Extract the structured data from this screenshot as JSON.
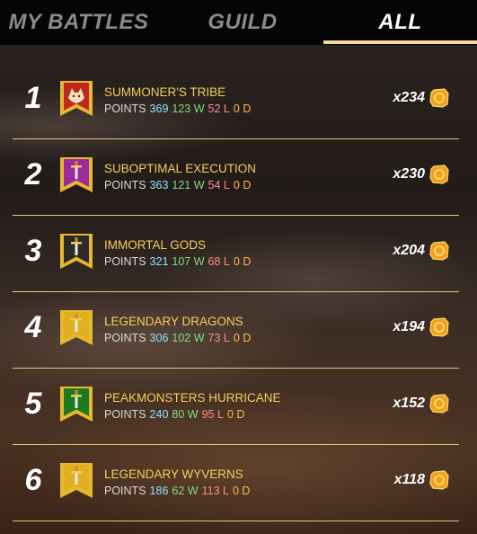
{
  "tabs": [
    {
      "label": "MY BATTLES"
    },
    {
      "label": "GUILD"
    },
    {
      "label": "ALL",
      "active": true
    }
  ],
  "stat_labels": {
    "points": "POINTS",
    "wins_suffix": "W",
    "losses_suffix": "L",
    "draws_suffix": "D"
  },
  "colors": {
    "accent": "#f3d99b",
    "team_name": "#f4cf5e",
    "points": "#8ee3ff",
    "wins": "#7fdc7f",
    "losses": "#ff8a8a",
    "draws": "#ffb84d"
  },
  "rows": [
    {
      "rank": "1",
      "name": "SUMMONER'S TRIBE",
      "points": "369",
      "wins": "123 W",
      "losses": "52 L",
      "draws": "0 D",
      "reward": "x234",
      "banner_icon": "wolf-banner-icon",
      "banner_color": "#c0281e"
    },
    {
      "rank": "2",
      "name": "SUBOPTIMAL EXECUTION",
      "points": "363",
      "wins": "121 W",
      "losses": "54 L",
      "draws": "0 D",
      "reward": "x230",
      "banner_icon": "sword-banner-icon",
      "banner_color": "#9a2a9e"
    },
    {
      "rank": "3",
      "name": "IMMORTAL GODS",
      "points": "321",
      "wins": "107 W",
      "losses": "68 L",
      "draws": "0 D",
      "reward": "x204",
      "banner_icon": "sword-banner-icon",
      "banner_color": "#2a2a2a"
    },
    {
      "rank": "4",
      "name": "LEGENDARY DRAGONS",
      "points": "306",
      "wins": "102 W",
      "losses": "73 L",
      "draws": "0 D",
      "reward": "x194",
      "banner_icon": "sword-banner-icon",
      "banner_color": "#e0b020"
    },
    {
      "rank": "5",
      "name": "PEAKMONSTERS HURRICANE",
      "points": "240",
      "wins": "80 W",
      "losses": "95 L",
      "draws": "0 D",
      "reward": "x152",
      "banner_icon": "sword-banner-icon",
      "banner_color": "#1e7a20"
    },
    {
      "rank": "6",
      "name": "LEGENDARY WYVERNS",
      "points": "186",
      "wins": "62 W",
      "losses": "113 L",
      "draws": "0 D",
      "reward": "x118",
      "banner_icon": "sword-banner-icon",
      "banner_color": "#e0b020"
    }
  ]
}
